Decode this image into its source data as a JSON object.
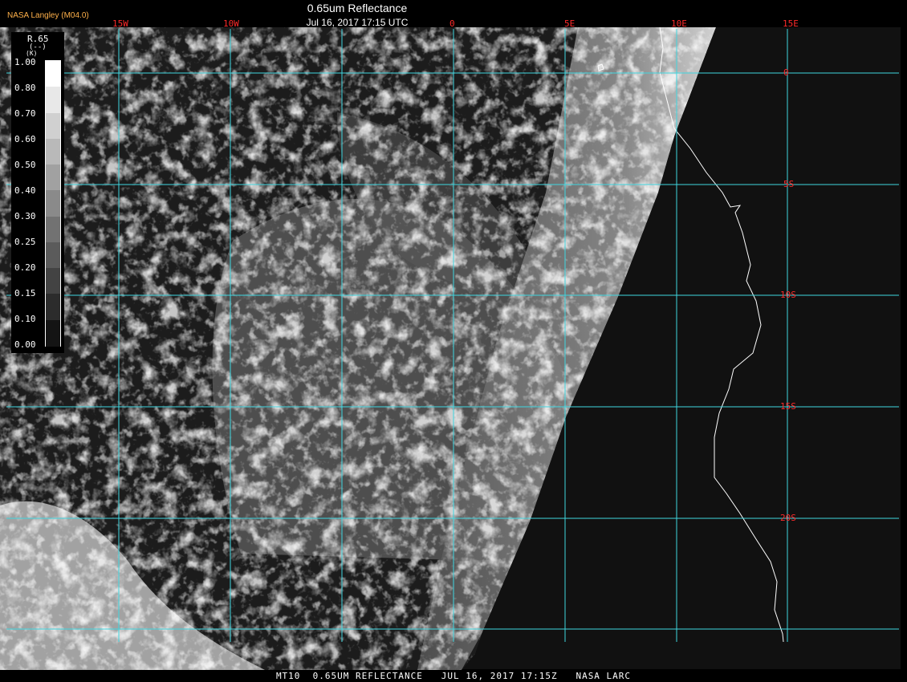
{
  "header": {
    "credit": "NASA Langley (M04.0)",
    "title": "0.65um Reflectance",
    "subtitle": "Jul 16, 2017 17:15 UTC"
  },
  "footer": "MT10  0.65UM REFLECTANCE   JUL 16, 2017 17:15Z   NASA LARC",
  "grid": {
    "color": "#3fd6e0",
    "longitudes": [
      "15W",
      "10W",
      "0",
      "5E",
      "10E",
      "15E"
    ],
    "latitudes": [
      "0",
      "5S",
      "10S",
      "15S",
      "20S"
    ]
  },
  "legend": {
    "name": "R.65",
    "unit": "(--)",
    "unit_sub": "(K)",
    "labels": [
      "1.00",
      "0.80",
      "0.70",
      "0.60",
      "0.50",
      "0.40",
      "0.30",
      "0.25",
      "0.20",
      "0.15",
      "0.10",
      "0.00"
    ]
  },
  "colors": {
    "tick_labels": "#ff2a2a",
    "coastline": "#ffffff",
    "credit": "#ffb14a"
  }
}
